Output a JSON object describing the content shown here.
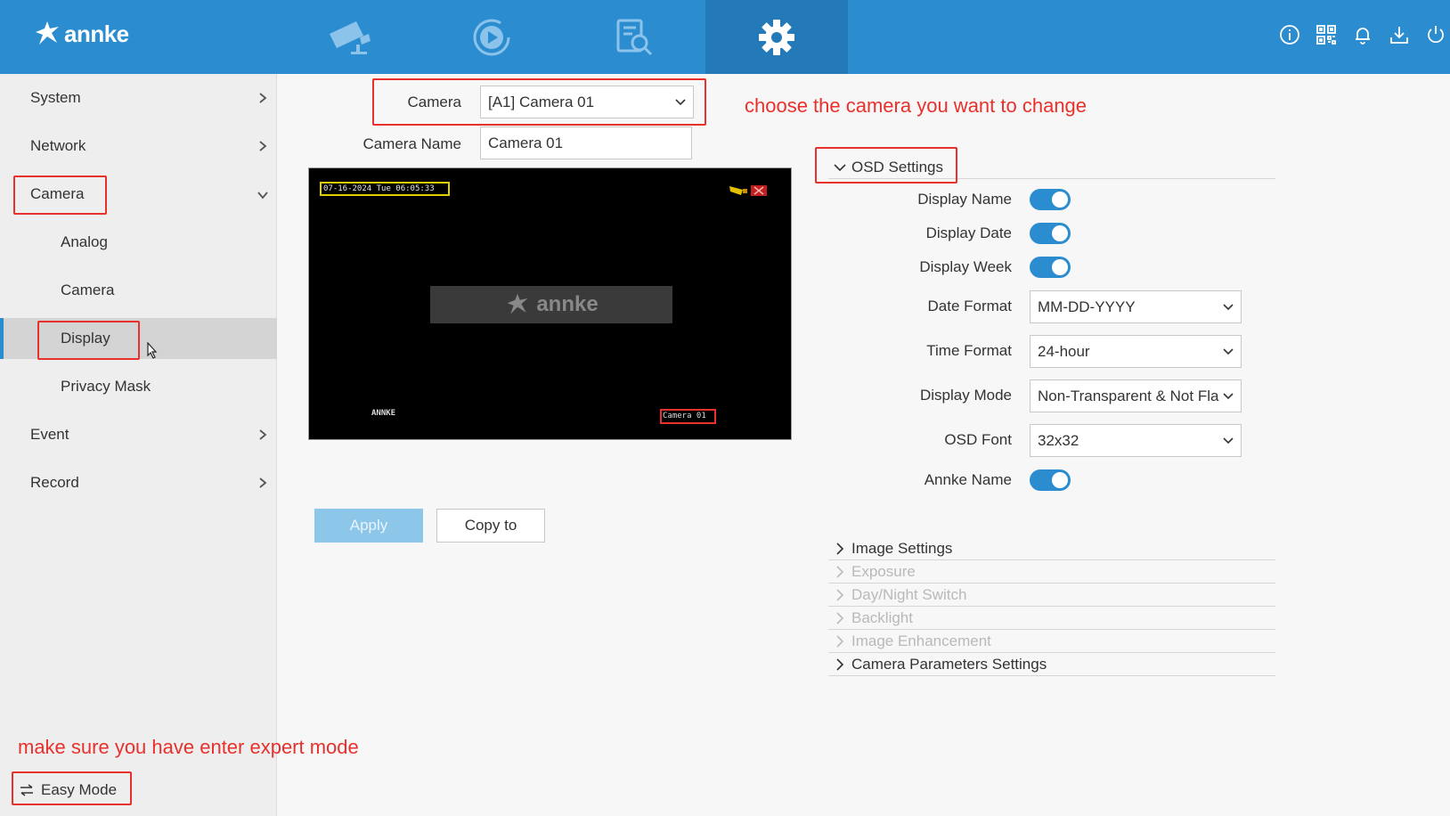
{
  "app": {
    "logo_text": "annke",
    "nav_tabs": [
      {
        "name": "live-view",
        "icon": "camera-icon"
      },
      {
        "name": "playback",
        "icon": "playback-icon"
      },
      {
        "name": "search",
        "icon": "file-search-icon"
      },
      {
        "name": "configuration",
        "icon": "gear-icon",
        "active": true
      }
    ],
    "top_icons": [
      "info-icon",
      "qr-code-icon",
      "bell-icon",
      "download-icon",
      "power-icon"
    ]
  },
  "sidebar": {
    "items": [
      {
        "label": "System"
      },
      {
        "label": "Network"
      },
      {
        "label": "Camera"
      },
      {
        "label": "Analog"
      },
      {
        "label": "Camera"
      },
      {
        "label": "Display"
      },
      {
        "label": "Privacy Mask"
      },
      {
        "label": "Event"
      },
      {
        "label": "Record"
      }
    ],
    "easy_mode_label": "Easy Mode"
  },
  "annotations": {
    "camera_hint": "choose the camera you want to change",
    "expert_hint": "make sure you have enter expert mode"
  },
  "form": {
    "camera_label": "Camera",
    "camera_value": "[A1] Camera 01",
    "camera_name_label": "Camera Name",
    "camera_name_value": "Camera 01",
    "apply_label": "Apply",
    "copy_label": "Copy to"
  },
  "preview": {
    "date_osd": "07-16-2024 Tue 06:05:33",
    "brand_text": "annke",
    "channel_osd": "ANNKE",
    "camera_osd": "Camera 01"
  },
  "osd": {
    "title": "OSD Settings",
    "display_name_label": "Display Name",
    "display_date_label": "Display Date",
    "display_week_label": "Display Week",
    "date_format_label": "Date Format",
    "date_format_value": "MM-DD-YYYY",
    "time_format_label": "Time Format",
    "time_format_value": "24-hour",
    "display_mode_label": "Display Mode",
    "display_mode_value": "Non-Transparent & Not Fla",
    "osd_font_label": "OSD Font",
    "osd_font_value": "32x32",
    "annke_name_label": "Annke Name"
  },
  "sections": [
    {
      "label": "Image Settings",
      "enabled": true
    },
    {
      "label": "Exposure",
      "enabled": false
    },
    {
      "label": "Day/Night Switch",
      "enabled": false
    },
    {
      "label": "Backlight",
      "enabled": false
    },
    {
      "label": "Image Enhancement",
      "enabled": false
    },
    {
      "label": "Camera Parameters Settings",
      "enabled": true
    }
  ],
  "colors": {
    "topbar": "#2b8cd0",
    "accent": "#2b8cd0",
    "annotation_red": "#e8302c"
  }
}
